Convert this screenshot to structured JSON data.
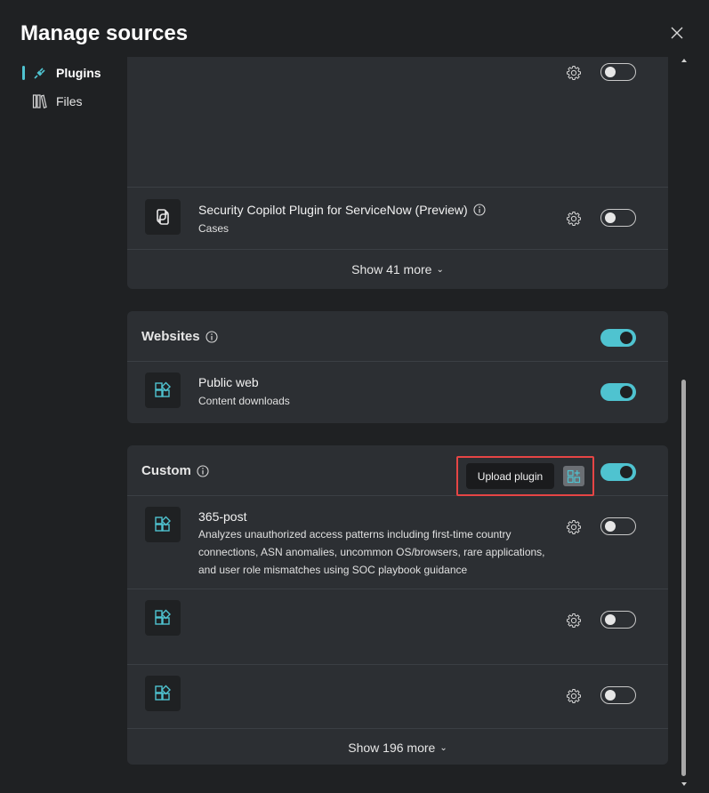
{
  "header": {
    "title": "Manage sources"
  },
  "nav": {
    "items": [
      {
        "label": "Plugins",
        "icon": "plug-icon",
        "active": true
      },
      {
        "label": "Files",
        "icon": "library-icon",
        "active": false
      }
    ]
  },
  "microsoft_section": {
    "rows": [
      {
        "title": "",
        "subtitle": "",
        "enabled": false
      },
      {
        "title": "Security Copilot Plugin for ServiceNow (Preview)",
        "subtitle": "Cases",
        "enabled": false
      }
    ],
    "show_more": "Show 41 more"
  },
  "websites_section": {
    "title": "Websites",
    "enabled": true,
    "rows": [
      {
        "title": "Public web",
        "subtitle": "Content downloads",
        "enabled": true
      }
    ]
  },
  "custom_section": {
    "title": "Custom",
    "enabled": true,
    "upload_tooltip": "Upload plugin",
    "rows": [
      {
        "title": "365-post",
        "description": "Analyzes unauthorized access patterns including first-time country connections, ASN anomalies, uncommon OS/browsers, rare applications, and user role mismatches using SOC playbook guidance",
        "enabled": false
      },
      {
        "title": "",
        "enabled": false
      },
      {
        "title": "",
        "enabled": false
      }
    ],
    "show_more": "Show 196 more"
  },
  "colors": {
    "accent": "#4fc3d0",
    "background": "#1f2123",
    "card": "#2c2f33",
    "highlight": "#e64545"
  }
}
